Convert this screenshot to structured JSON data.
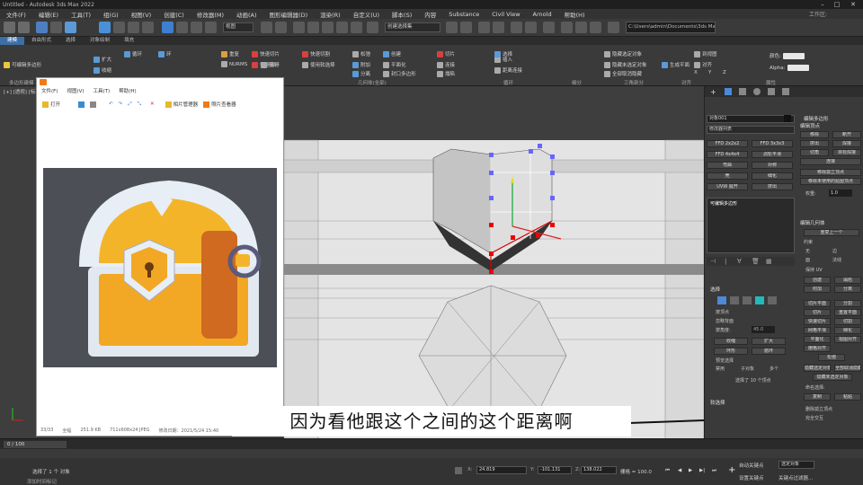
{
  "window": {
    "title": "Untitled - Autodesk 3ds Max 2022",
    "workspace_label": "工作区:"
  },
  "menu": [
    "文件(F)",
    "编辑(E)",
    "工具(T)",
    "组(G)",
    "视图(V)",
    "创建(C)",
    "修改器(M)",
    "动画(A)",
    "图形编辑器(D)",
    "渲染(R)",
    "自定义(U)",
    "脚本(S)",
    "内容",
    "Substance",
    "Civil View",
    "Arnold",
    "帮助(H)"
  ],
  "toolbar": {
    "filter_dropdown": "全部",
    "view_dropdown": "视图",
    "selection_set": "创建选择集",
    "path": "C:\\Users\\admin\\Documents\\3ds Max 2022"
  },
  "tabs": [
    "建模",
    "自由形式",
    "选择",
    "对象绘制",
    "填充"
  ],
  "ribbon": {
    "items": [
      "可编辑多边形",
      "扩大",
      "收缩",
      "循环",
      "环",
      "重复",
      "快速切片",
      "快速循环",
      "快速切割",
      "NURMS",
      "剪切",
      "使用软选择",
      "松弛",
      "创建",
      "附加",
      "分离",
      "平面化",
      "切片",
      "连接",
      "插入",
      "距离连接",
      "塌陷",
      "封口多边形",
      "选择",
      "隐藏选定对象",
      "隐藏未选定对象",
      "全部取消隐藏",
      "生成平面",
      "到视图",
      "对齐",
      "X",
      "Y",
      "Z",
      "颜色:",
      "Alpha:"
    ],
    "groups": [
      "多边形建模",
      "几何体(全部)",
      "循环",
      "细分",
      "三角剖分",
      "对齐",
      "属性"
    ]
  },
  "image_viewer": {
    "menu": [
      "文件(F)",
      "视图(V)",
      "工具(T)",
      "帮助(H)"
    ],
    "tools": [
      "打开",
      "相片管理器",
      "照片查看器"
    ],
    "status": [
      "33/33",
      "全幅",
      "251.9 KB",
      "711x608x24 JPEG",
      "修改日期：2021/5/24 15:40"
    ]
  },
  "command_panel": {
    "object_name": "对象001",
    "modifier_list": "修改器列表",
    "modifier_title": "编辑多边形",
    "modifier_stack_item": "可编辑多边形",
    "buttons": [
      "FFD 2x2x2",
      "FFD 3x3x3",
      "FFD 4x4x4",
      "涡轮平滑",
      "弯曲",
      "对称",
      "壳",
      "细化",
      "UVW 展开",
      "挤出"
    ],
    "edit_vertices": {
      "title": "编辑顶点",
      "buttons": [
        "移除",
        "断开",
        "挤出",
        "焊接",
        "切角",
        "目标焊接",
        "连接",
        "移除孤立顶点",
        "移除未使用的贴图顶点"
      ],
      "weight_label": "权重:",
      "weight_value": "1.0"
    },
    "edit_geometry": {
      "title": "编辑几何体",
      "repeat_last": "重复上一个",
      "constraints_label": "约束",
      "constraints": [
        "无",
        "边",
        "面",
        "法线"
      ],
      "preserve_uv": "保持 UV",
      "buttons": [
        "创建",
        "塌陷",
        "附加",
        "分离",
        "切片平面",
        "分割",
        "切片",
        "重置平面",
        "快速切片",
        "切割",
        "网格平滑",
        "细化",
        "平面化",
        "视图对齐",
        "栅格对齐",
        "松弛",
        "隐藏选定对象",
        "全部取消隐藏",
        "隐藏未选定对象"
      ],
      "named_selection_label": "命名选择:",
      "copy": "复制",
      "paste": "粘贴",
      "delete_isolated": "删除孤立顶点",
      "full_interactivity": "完全交互"
    },
    "selection": {
      "title": "选择",
      "by_vertex": "按顶点",
      "ignore_backfacing": "忽略背面",
      "by_angle": "按角度:",
      "by_angle_value": "45.0",
      "shrink": "收缩",
      "grow": "扩大",
      "ring": "环形",
      "loop": "循环",
      "preview_label": "预览选择",
      "preview_options": [
        "禁用",
        "子对象",
        "多个"
      ],
      "status": "选择了 10 个顶点"
    },
    "soft_selection": {
      "title": "软选择"
    }
  },
  "timeline": {
    "frame": "0 / 100"
  },
  "status": {
    "selected": "选择了 1 个 对象",
    "x_value": "24.819",
    "y_value": "-101.131",
    "z_value": "138.022",
    "grid": "栅格 = 100.0",
    "add_key": "添加时间标记",
    "auto_key": "自动关键点",
    "selected_obj": "选定对象",
    "set_key": "设置关键点",
    "key_filter": "关键点过滤器..."
  },
  "viewport_label": "[+] [透视] [标准] [默认明暗处理]",
  "subtitle": "因为看他跟这个之间的这个距离啊"
}
